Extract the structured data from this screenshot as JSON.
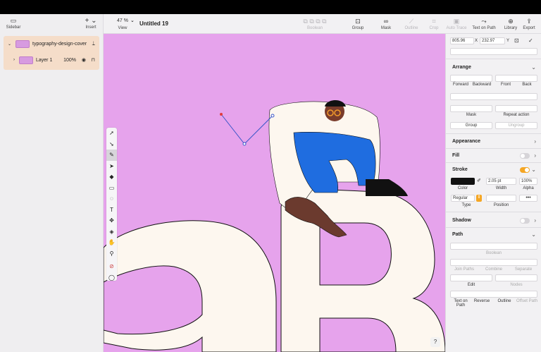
{
  "sidebar": {
    "sidebar_label": "Sidebar",
    "insert_label": "Insert",
    "layers": [
      {
        "name": "typography-design-cover"
      },
      {
        "name": "Layer 1",
        "opacity": "100%"
      }
    ]
  },
  "toolbar": {
    "zoom": "47 %",
    "view_label": "View",
    "document_title": "Untitled 19",
    "items": [
      {
        "label": "Boolean",
        "icon": "boolean-icon",
        "enabled": false
      },
      {
        "label": "Group",
        "icon": "group-icon",
        "enabled": true
      },
      {
        "label": "Mask",
        "icon": "mask-icon",
        "enabled": true
      },
      {
        "label": "Outline",
        "icon": "outline-icon",
        "enabled": false
      },
      {
        "label": "Crop",
        "icon": "crop-icon",
        "enabled": false
      },
      {
        "label": "Auto Trace",
        "icon": "auto-trace-icon",
        "enabled": false
      },
      {
        "label": "Text on Path",
        "icon": "text-on-path-icon",
        "enabled": true
      },
      {
        "label": "Library",
        "icon": "library-icon",
        "enabled": true
      },
      {
        "label": "Export",
        "icon": "export-icon",
        "enabled": true
      }
    ]
  },
  "inspector": {
    "x_value": "805.96",
    "x_label": "X",
    "y_value": "232.97",
    "y_label": "Y",
    "arrange": {
      "title": "Arrange",
      "forward": "Forward",
      "backward": "Backward",
      "front": "Front",
      "back": "Back",
      "mask": "Mask",
      "repeat_action": "Repeat action",
      "group": "Group",
      "ungroup": "Ungroup"
    },
    "appearance_title": "Appearance",
    "fill_title": "Fill",
    "stroke": {
      "title": "Stroke",
      "width_value": "2.05 pt",
      "alpha_value": "100%",
      "color_label": "Color",
      "width_label": "Width",
      "alpha_label": "Alpha",
      "type_value": "Regular",
      "type_label": "Type",
      "position_label": "Position",
      "color": "#111111"
    },
    "shadow_title": "Shadow",
    "path": {
      "title": "Path",
      "boolean": "Boolean",
      "join_paths": "Join Paths",
      "combine": "Combine",
      "separate": "Separate",
      "edit": "Edit",
      "nodes": "Nodes",
      "text_on_path": "Text on Path",
      "reverse": "Reverse",
      "outline": "Outline",
      "offset_path": "Offset Path"
    }
  },
  "canvas": {
    "background": "#e6a3ec",
    "help_label": "?"
  },
  "colors": {
    "accent": "#f5a623",
    "layer_highlight": "#f5ddc9"
  }
}
